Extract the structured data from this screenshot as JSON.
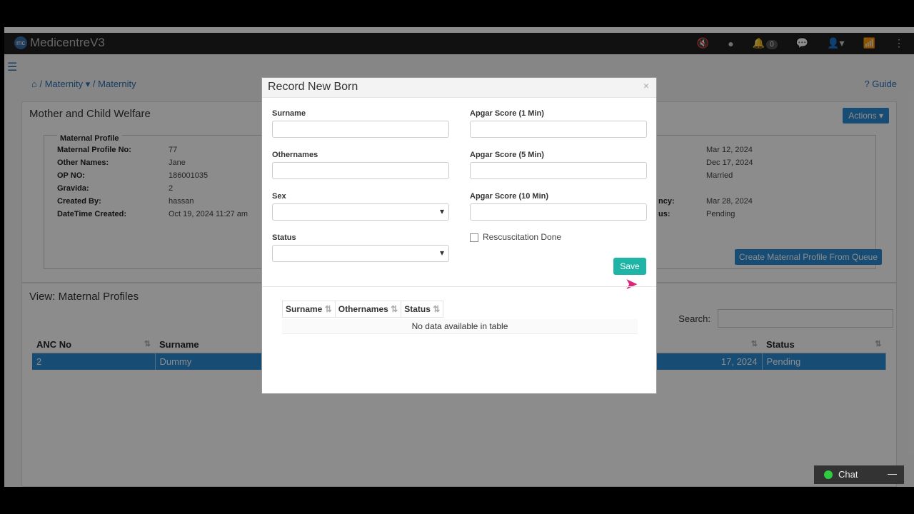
{
  "navbar": {
    "brand": "MedicentreV3",
    "notifications_count": "0"
  },
  "breadcrumb": {
    "item1": "Maternity",
    "item2": "Maternity"
  },
  "guide_label": "Guide",
  "panel": {
    "title": "Mother and Child Welfare",
    "actions_label": "Actions",
    "legend": "Maternal Profile",
    "fields": [
      {
        "label": "Maternal Profile No:",
        "value": "77"
      },
      {
        "label": "Other Names:",
        "value": "Jane"
      },
      {
        "label": "OP NO:",
        "value": "186001035"
      },
      {
        "label": "Gravida:",
        "value": "2"
      },
      {
        "label": "Created By:",
        "value": "hassan"
      },
      {
        "label": "DateTime Created:",
        "value": "Oct 19, 2024 11:27 am"
      }
    ],
    "right_partial_labels": [
      "ncy:",
      "us:"
    ],
    "right_values": [
      "Mar 12, 2024",
      "Dec 17, 2024",
      "Married",
      "Mar 28, 2024",
      "Pending"
    ],
    "create_button": "Create Maternal Profile From Queue"
  },
  "profiles": {
    "title": "View: Maternal Profiles",
    "search_label": "Search:",
    "columns": [
      "ANC No",
      "Surname",
      "Status"
    ],
    "row": {
      "anc": "2",
      "surname": "Dummy",
      "date_partial": "17, 2024",
      "status": "Pending"
    }
  },
  "modal": {
    "title": "Record New Born",
    "close": "×",
    "surname_label": "Surname",
    "othernames_label": "Othernames",
    "sex_label": "Sex",
    "status_label": "Status",
    "apgar1_label": "Apgar Score (1 Min)",
    "apgar5_label": "Apgar Score (5 Min)",
    "apgar10_label": "Apgar Score (10 Min)",
    "resuscitation_label": "Rescuscitation Done",
    "save_label": "Save",
    "table_columns": [
      "Surname",
      "Othernames",
      "Status"
    ],
    "no_data": "No data available in table"
  },
  "chat": {
    "label": "Chat",
    "minimize": "—"
  },
  "colors": {
    "primary": "#2a8ad6",
    "save": "#1fb5a6",
    "navbar": "#1f1f1f"
  }
}
